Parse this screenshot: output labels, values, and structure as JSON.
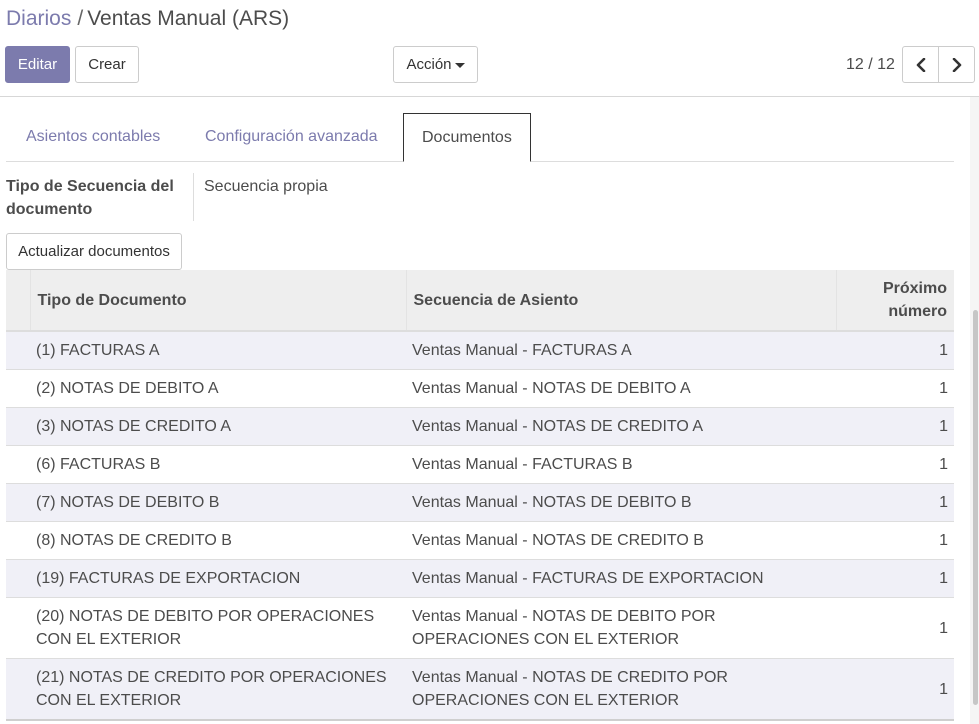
{
  "breadcrumb": {
    "parent": "Diarios",
    "separator": "/",
    "current": "Ventas Manual (ARS)"
  },
  "toolbar": {
    "edit_label": "Editar",
    "create_label": "Crear",
    "action_label": "Acción"
  },
  "pager": {
    "value": "12 / 12",
    "prev_icon": "chevron-left-icon",
    "next_icon": "chevron-right-icon"
  },
  "tabs": [
    {
      "label": "Asientos contables",
      "active": false
    },
    {
      "label": "Configuración avanzada",
      "active": false
    },
    {
      "label": "Documentos",
      "active": true
    }
  ],
  "sequence_field": {
    "label": "Tipo de Secuencia del documento",
    "value": "Secuencia propia"
  },
  "update_button": "Actualizar documentos",
  "table": {
    "headers": {
      "type": "Tipo de Documento",
      "sequence": "Secuencia de Asiento",
      "next": "Próximo número"
    },
    "rows": [
      {
        "type": "(1) FACTURAS A",
        "sequence": "Ventas Manual - FACTURAS A",
        "next": "1"
      },
      {
        "type": "(2) NOTAS DE DEBITO A",
        "sequence": "Ventas Manual - NOTAS DE DEBITO A",
        "next": "1"
      },
      {
        "type": "(3) NOTAS DE CREDITO A",
        "sequence": "Ventas Manual - NOTAS DE CREDITO A",
        "next": "1"
      },
      {
        "type": "(6) FACTURAS B",
        "sequence": "Ventas Manual - FACTURAS B",
        "next": "1"
      },
      {
        "type": "(7) NOTAS DE DEBITO B",
        "sequence": "Ventas Manual - NOTAS DE DEBITO B",
        "next": "1"
      },
      {
        "type": "(8) NOTAS DE CREDITO B",
        "sequence": "Ventas Manual - NOTAS DE CREDITO B",
        "next": "1"
      },
      {
        "type": "(19) FACTURAS DE EXPORTACION",
        "sequence": "Ventas Manual - FACTURAS DE EXPORTACION",
        "next": "1"
      },
      {
        "type": "(20) NOTAS DE DEBITO POR OPERACIONES CON EL EXTERIOR",
        "sequence": "Ventas Manual - NOTAS DE DEBITO POR OPERACIONES CON EL EXTERIOR",
        "next": "1"
      },
      {
        "type": "(21) NOTAS DE CREDITO POR OPERACIONES CON EL EXTERIOR",
        "sequence": "Ventas Manual - NOTAS DE CREDITO POR OPERACIONES CON EL EXTERIOR",
        "next": "1"
      }
    ]
  },
  "colors": {
    "brand": "#7c7bad",
    "row_stripe": "#f0f0f7",
    "header_bg": "#eeeeee"
  }
}
